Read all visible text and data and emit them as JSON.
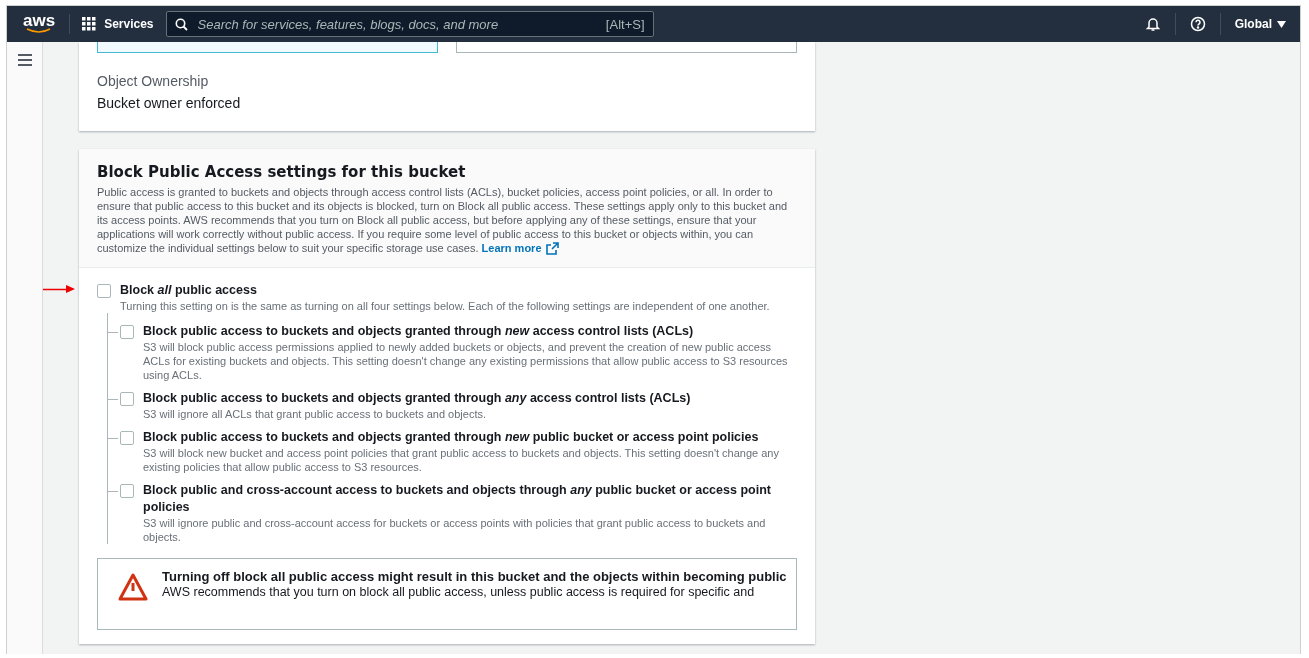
{
  "navbar": {
    "logo": "aws",
    "services": "Services",
    "search": {
      "placeholder": "Search for services, features, blogs, docs, and more",
      "shortcut": "[Alt+S]"
    },
    "region": "Global"
  },
  "ownership": {
    "label": "Object Ownership",
    "value": "Bucket owner enforced"
  },
  "block_public_access": {
    "title": "Block Public Access settings for this bucket",
    "description": "Public access is granted to buckets and objects through access control lists (ACLs), bucket policies, access point policies, or all. In order to ensure that public access to this bucket and its objects is blocked, turn on Block all public access. These settings apply only to this bucket and its access points. AWS recommends that you turn on Block all public access, but before applying any of these settings, ensure that your applications will work correctly without public access. If you require some level of public access to this bucket or objects within, you can customize the individual settings below to suit your specific storage use cases.",
    "learn_more": "Learn more",
    "main_option": {
      "label": "Block *all* public access",
      "description": "Turning this setting on is the same as turning on all four settings below. Each of the following settings are independent of one another.",
      "checked": false,
      "children": [
        {
          "label": "Block public access to buckets and objects granted through *new* access control lists (ACLs)",
          "description": "S3 will block public access permissions applied to newly added buckets or objects, and prevent the creation of new public access ACLs for existing buckets and objects. This setting doesn't change any existing permissions that allow public access to S3 resources using ACLs.",
          "checked": false
        },
        {
          "label": "Block public access to buckets and objects granted through *any* access control lists (ACLs)",
          "description": "S3 will ignore all ACLs that grant public access to buckets and objects.",
          "checked": false
        },
        {
          "label": "Block public access to buckets and objects granted through *new* public bucket or access point policies",
          "description": "S3 will block new bucket and access point policies that grant public access to buckets and objects. This setting doesn't change any existing policies that allow public access to S3 resources.",
          "checked": false
        },
        {
          "label": "Block public and cross-account access to buckets and objects through *any* public bucket or access point policies",
          "description": "S3 will ignore public and cross-account access for buckets or access points with policies that grant public access to buckets and objects.",
          "checked": false
        }
      ]
    },
    "warning": {
      "title": "Turning off block all public access might result in this bucket and the objects within becoming public",
      "text": "AWS recommends that you turn on block all public access, unless public access is required for specific and"
    }
  }
}
